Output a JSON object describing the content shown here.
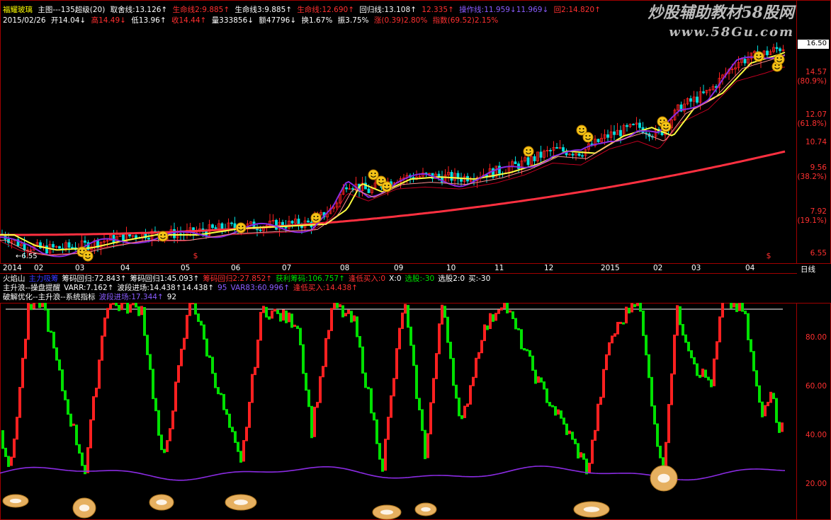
{
  "header": {
    "stock_name": "福耀玻璃",
    "chart_label": "主图---135超级(20)",
    "line1": "取舍线:13.126↑",
    "line2": "生命线2:9.885↑",
    "line3": "生命线3:9.885↑",
    "line4": "生命线:12.690↑",
    "line5": "回归线:13.108↑",
    "line6": "12.335↑",
    "line7": "操作线:11.959↓11.969↓",
    "line8": "回2:14.820↑",
    "date": "2015/02/26",
    "open": "开14.04↓",
    "high": "高14.49↓",
    "low": "低13.96↑",
    "close": "收14.44↑",
    "volume": "量333856↓",
    "amount": "额47796↓",
    "turnover": "换1.67%",
    "amplitude": "振3.75%",
    "change": "涨(0.39)2.80%",
    "index": "指数(69.52)2.15%"
  },
  "price_axis": {
    "current_price": "16.50",
    "labels": [
      {
        "text": "14.57",
        "sub": "(80.9%)"
      },
      {
        "text": "12.07",
        "sub": "(61.8%)"
      },
      {
        "text": "10.74",
        "sub": ""
      },
      {
        "text": "9.56",
        "sub": "(38.2%)"
      },
      {
        "text": "7.92",
        "sub": "(19.1%)"
      },
      {
        "text": "6.55",
        "sub": ""
      }
    ],
    "low_marker": "6.55"
  },
  "time_axis": {
    "labels": [
      "2014",
      "02",
      "03",
      "04",
      "05",
      "06",
      "07",
      "08",
      "09",
      "10",
      "11",
      "12",
      "2015",
      "02",
      "03",
      "04"
    ],
    "period_button": "日线"
  },
  "indicator_rows": {
    "row1": [
      "火焰山",
      "主力吸筹",
      "筹码回归:72.843↑",
      "筹码回归1:45.093↑",
      "筹码回归2:27.852↑",
      "获利筹码:106.757↑",
      "逢低买入:0",
      "X:0",
      "选股:-30",
      "选股2:0",
      "买:-30"
    ],
    "row2": [
      "主升浪--操盘提醒",
      "VARR:7.162↑",
      "波段进场:14.438↑14.438↑",
      "95",
      "VAR83:60.996↑",
      "逢低买入:14.438↑"
    ],
    "row3": [
      "破解优化--主升浪--系统指标",
      "波段进场:17.344↑",
      "92"
    ]
  },
  "osc_axis": [
    "80.00",
    "60.00",
    "40.00",
    "20.00"
  ],
  "watermark": {
    "line1": "炒股辅助教材58股网",
    "line2": "www.58Gu.com"
  },
  "colors": {
    "up": "#ff2020",
    "down": "#00e000",
    "yellow": "#ffff40",
    "purple": "#8a2be2",
    "ma_red": "#e60012",
    "frame": "#a00000"
  }
}
